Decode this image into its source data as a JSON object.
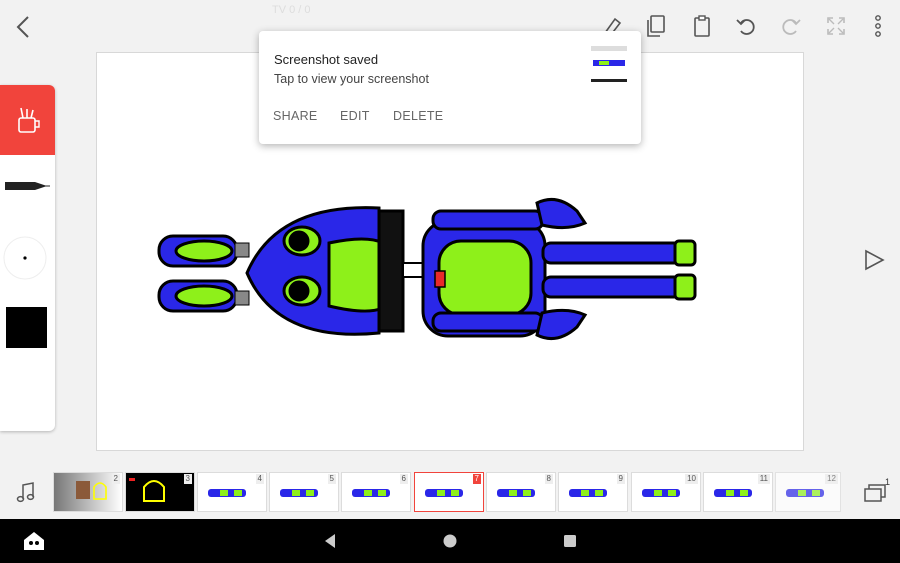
{
  "status_bar": {
    "title": "TV 0 / 0"
  },
  "toolbar": {
    "back_icon": "chevron-left-icon",
    "icons": [
      "eraser-icon",
      "copy-icon",
      "paste-icon",
      "undo-icon",
      "redo-icon",
      "fullscreen-icon",
      "more-vert-icon"
    ]
  },
  "toast": {
    "title": "Screenshot saved",
    "subtitle": "Tap to view your screenshot",
    "actions": [
      "SHARE",
      "EDIT",
      "DELETE"
    ]
  },
  "timeline": {
    "frames": [
      "2",
      "3",
      "4",
      "5",
      "6",
      "7",
      "8",
      "9",
      "10",
      "11",
      "12"
    ],
    "active_frame": "7",
    "layer_count": "1"
  },
  "colors": {
    "accent": "#f1443c",
    "robot_blue": "#2a27e8",
    "robot_green": "#8ef01a",
    "current_color": "#000000"
  }
}
